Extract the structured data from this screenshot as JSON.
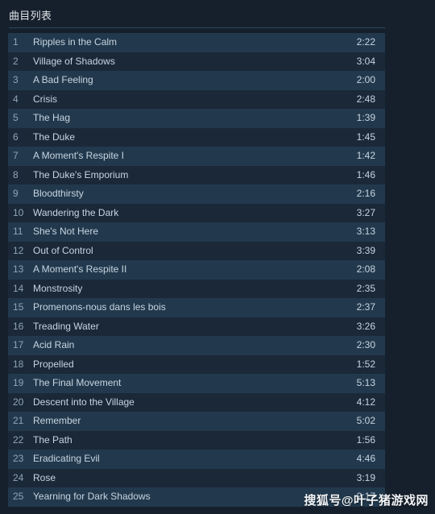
{
  "panel": {
    "title": "曲目列表"
  },
  "watermark": {
    "text": "搜狐号@叶子猪游戏网"
  },
  "colors": {
    "background": "#16202d",
    "row_odd": "#22394d",
    "row_even": "#1b2838",
    "divider": "#2a475e",
    "text_primary": "#c6d4e1",
    "text_number": "#8fa4b6",
    "title": "#dfe3e6"
  },
  "tracks": [
    {
      "num": "1",
      "name": "Ripples in the Calm",
      "time": "2:22"
    },
    {
      "num": "2",
      "name": "Village of Shadows",
      "time": "3:04"
    },
    {
      "num": "3",
      "name": "A Bad Feeling",
      "time": "2:00"
    },
    {
      "num": "4",
      "name": "Crisis",
      "time": "2:48"
    },
    {
      "num": "5",
      "name": "The Hag",
      "time": "1:39"
    },
    {
      "num": "6",
      "name": "The Duke",
      "time": "1:45"
    },
    {
      "num": "7",
      "name": "A Moment's Respite I",
      "time": "1:42"
    },
    {
      "num": "8",
      "name": "The Duke's Emporium",
      "time": "1:46"
    },
    {
      "num": "9",
      "name": "Bloodthirsty",
      "time": "2:16"
    },
    {
      "num": "10",
      "name": "Wandering the Dark",
      "time": "3:27"
    },
    {
      "num": "11",
      "name": "She's Not Here",
      "time": "3:13"
    },
    {
      "num": "12",
      "name": "Out of Control",
      "time": "3:39"
    },
    {
      "num": "13",
      "name": "A Moment's Respite II",
      "time": "2:08"
    },
    {
      "num": "14",
      "name": "Monstrosity",
      "time": "2:35"
    },
    {
      "num": "15",
      "name": "Promenons-nous dans les bois",
      "time": "2:37"
    },
    {
      "num": "16",
      "name": "Treading Water",
      "time": "3:26"
    },
    {
      "num": "17",
      "name": "Acid Rain",
      "time": "2:30"
    },
    {
      "num": "18",
      "name": "Propelled",
      "time": "1:52"
    },
    {
      "num": "19",
      "name": "The Final Movement",
      "time": "5:13"
    },
    {
      "num": "20",
      "name": "Descent into the Village",
      "time": "4:12"
    },
    {
      "num": "21",
      "name": "Remember",
      "time": "5:02"
    },
    {
      "num": "22",
      "name": "The Path",
      "time": "1:56"
    },
    {
      "num": "23",
      "name": "Eradicating Evil",
      "time": "4:46"
    },
    {
      "num": "24",
      "name": "Rose",
      "time": "3:19"
    },
    {
      "num": "25",
      "name": "Yearning for Dark Shadows",
      "time": "2:17"
    }
  ]
}
